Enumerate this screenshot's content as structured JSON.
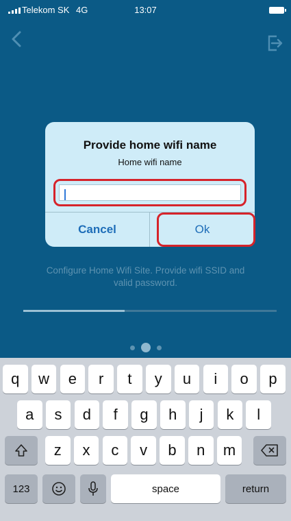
{
  "status_bar": {
    "carrier": "Telekom SK",
    "network": "4G",
    "time": "13:07"
  },
  "nav": {
    "back_icon": "chevron-left-icon",
    "logout_icon": "logout-icon"
  },
  "background": {
    "description_line1": "Configure Home Wifi Site. Provide wifi SSID and",
    "description_line2": "valid password.",
    "progress_fraction": 0.4,
    "page_dots": 3,
    "active_dot": 1
  },
  "dialog": {
    "title": "Provide home wifi name",
    "message": "Home wifi name",
    "input_value": "",
    "cancel_label": "Cancel",
    "ok_label": "Ok"
  },
  "keyboard": {
    "row1": [
      "q",
      "w",
      "e",
      "r",
      "t",
      "y",
      "u",
      "i",
      "o",
      "p"
    ],
    "row2": [
      "a",
      "s",
      "d",
      "f",
      "g",
      "h",
      "j",
      "k",
      "l"
    ],
    "row3": [
      "z",
      "x",
      "c",
      "v",
      "b",
      "n",
      "m"
    ],
    "shift_icon": "shift-icon",
    "delete_icon": "delete-icon",
    "numbers_label": "123",
    "emoji_icon": "emoji-icon",
    "mic_icon": "microphone-icon",
    "space_label": "space",
    "return_label": "return"
  },
  "colors": {
    "background": "#0b5a86",
    "dialog": "#cfecf8",
    "button_text": "#1e6db8",
    "highlight": "#d6232a"
  }
}
